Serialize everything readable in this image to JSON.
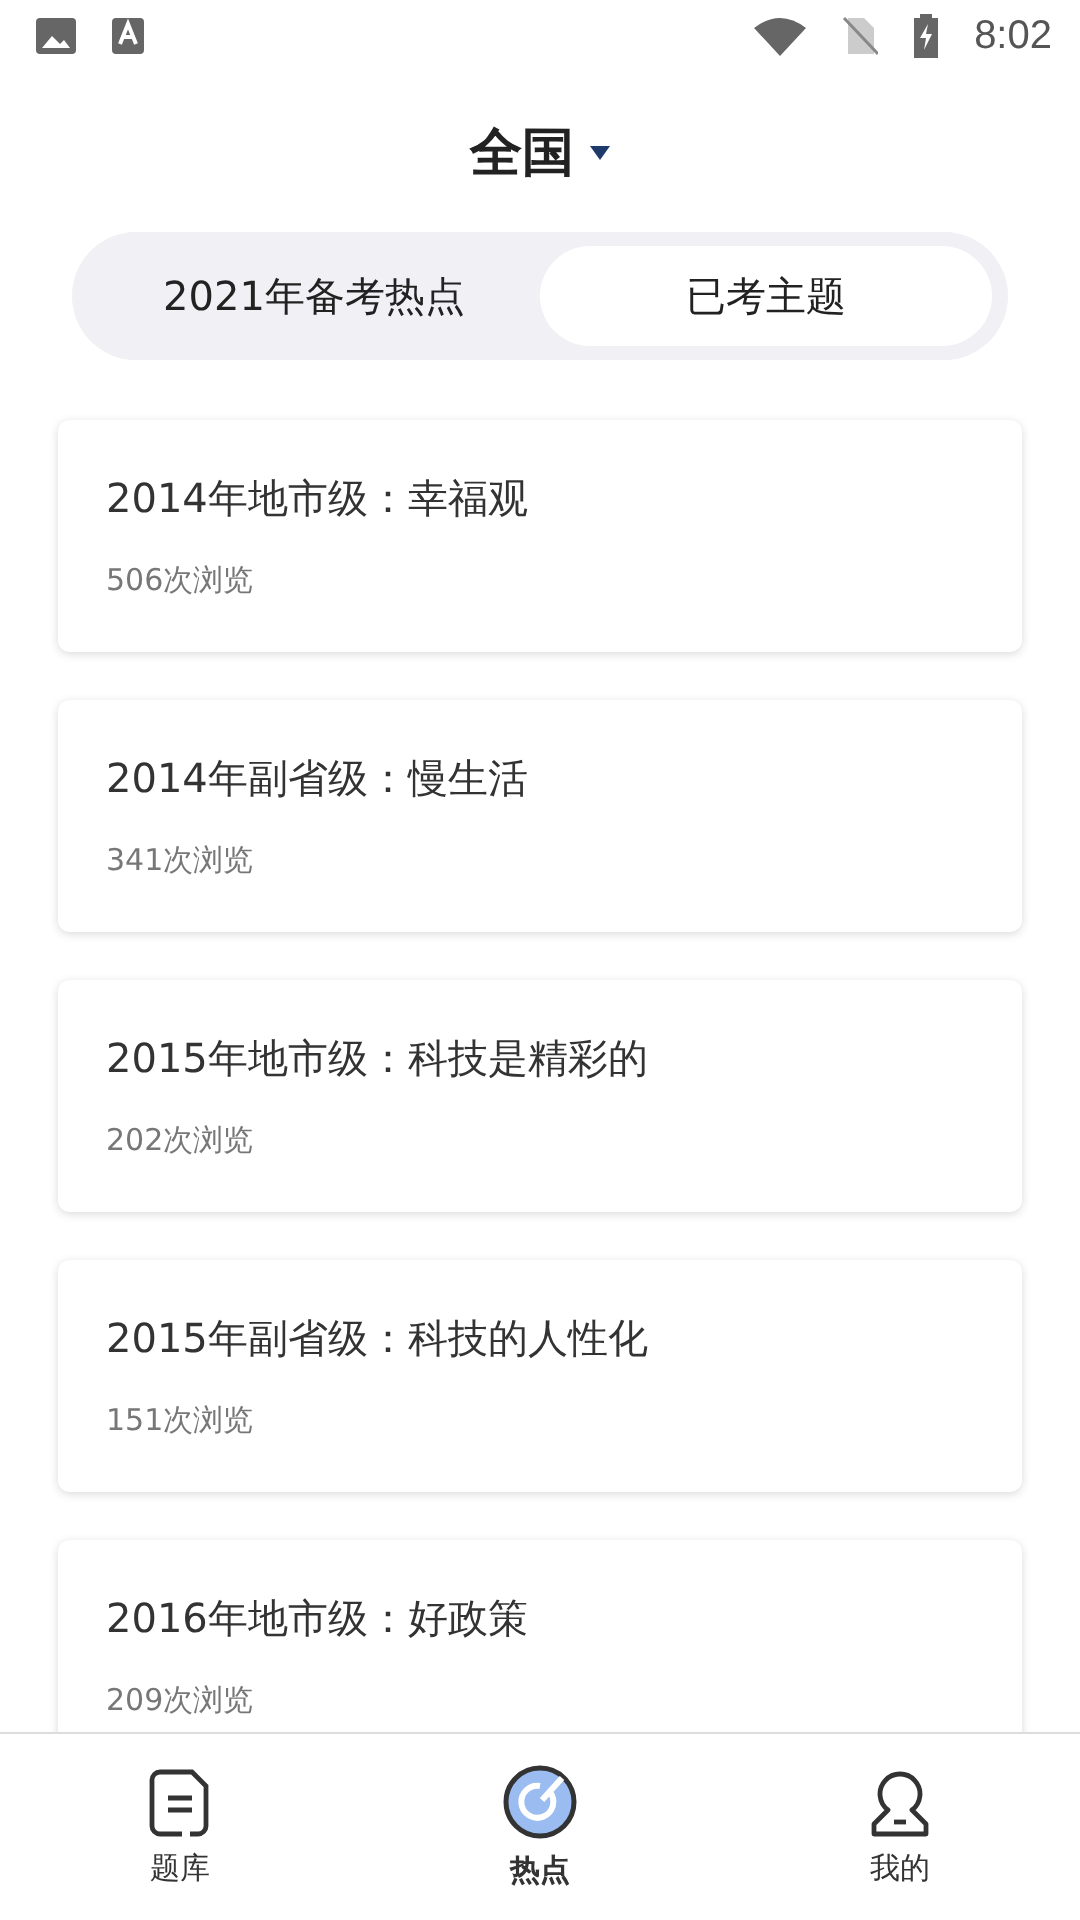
{
  "status_bar": {
    "time": "8:02"
  },
  "header": {
    "title": "全国"
  },
  "segments": [
    {
      "label": "2021年备考热点",
      "selected": false
    },
    {
      "label": "已考主题",
      "selected": true
    }
  ],
  "topics": [
    {
      "title": "2014年地市级：幸福观",
      "views": "506次浏览"
    },
    {
      "title": "2014年副省级：慢生活",
      "views": "341次浏览"
    },
    {
      "title": "2015年地市级：科技是精彩的",
      "views": "202次浏览"
    },
    {
      "title": "2015年副省级：科技的人性化",
      "views": "151次浏览"
    },
    {
      "title": "2016年地市级：好政策",
      "views": "209次浏览"
    }
  ],
  "bottom_nav": [
    {
      "label": "题库",
      "kind": "document",
      "selected": false
    },
    {
      "label": "热点",
      "kind": "target",
      "selected": true
    },
    {
      "label": "我的",
      "kind": "person",
      "selected": false
    }
  ]
}
